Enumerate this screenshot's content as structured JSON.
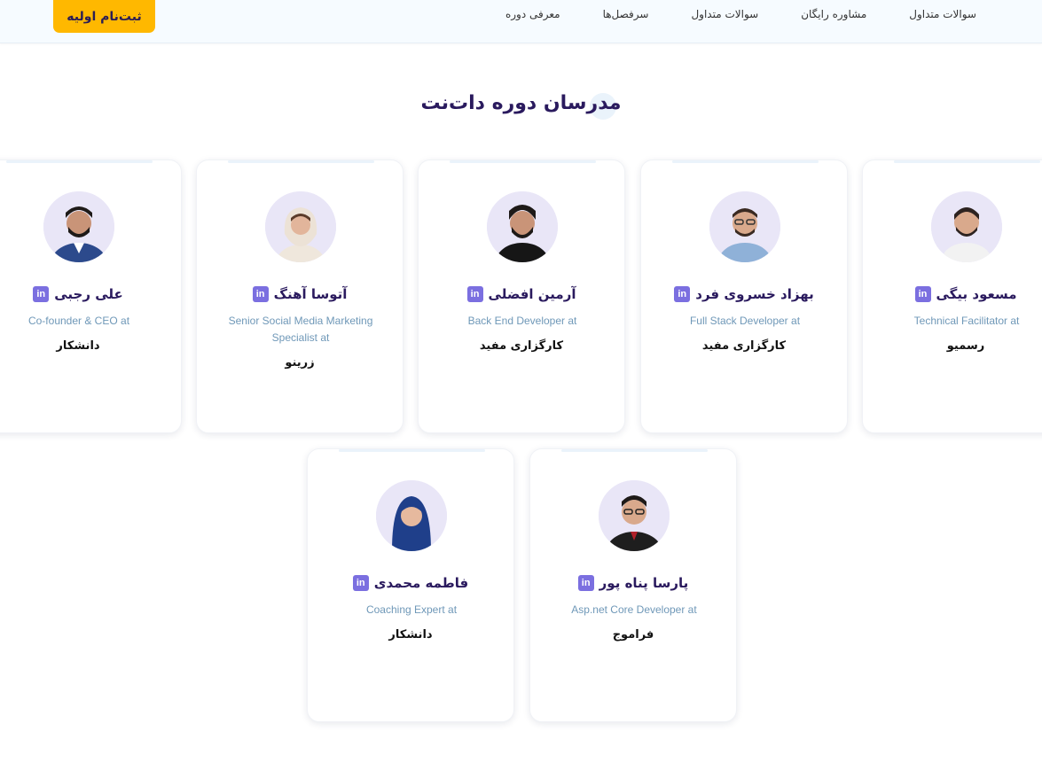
{
  "header": {
    "cta_label": "ثبت‌نام اولیه",
    "nav": [
      "معرفی دوره",
      "سرفصل‌ها",
      "سوالات متداول",
      "مشاوره رایگان",
      "سوالات متداول"
    ]
  },
  "section": {
    "title": "مدرسان دوره دات‌نت"
  },
  "instructors": [
    {
      "name": "مسعود بیگی",
      "role": "Technical Facilitator at",
      "company": "رسمیو"
    },
    {
      "name": "بهزاد خسروی فرد",
      "role": "Full Stack Developer at",
      "company": "کارگزاری مفید"
    },
    {
      "name": "آرمین افضلی",
      "role": "Back End Developer at",
      "company": "کارگزاری مفید"
    },
    {
      "name": "آتوسا آهنگ",
      "role": "Senior Social Media Marketing Specialist at",
      "company": "زرینو"
    },
    {
      "name": "علی رجبی",
      "role": "Co-founder & CEO at",
      "company": "دانشکار"
    },
    {
      "name": "پارسا پناه پور",
      "role": "Asp.net Core Developer at",
      "company": "فراموج"
    },
    {
      "name": "فاطمه محمدی",
      "role": "Coaching Expert at",
      "company": "دانشکار"
    }
  ],
  "linkedin_icon": "in",
  "colors": {
    "accent": "#ffb800",
    "title": "#2a1a5e",
    "role": "#6f98b8",
    "linkedin": "#7b6fe0"
  }
}
